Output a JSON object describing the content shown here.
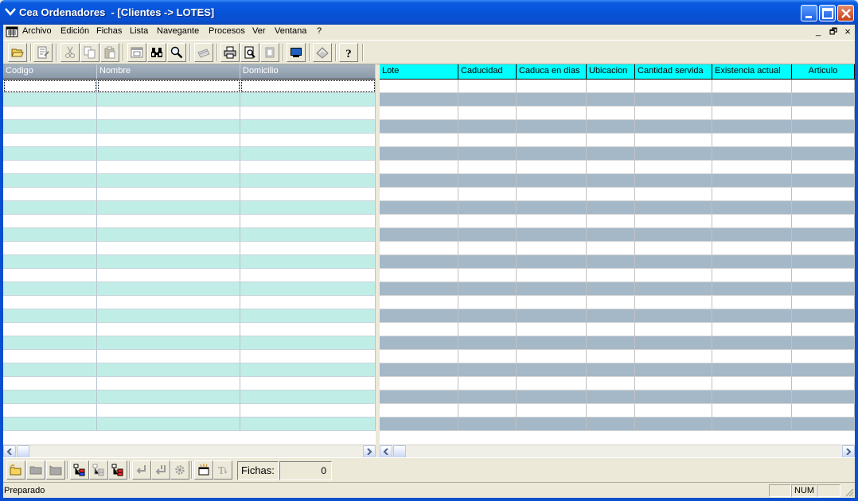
{
  "window": {
    "title": "Cea Ordenadores  - [Clientes -> LOTES]"
  },
  "menubar": {
    "items": [
      "Archivo",
      "Edición",
      "Fichas",
      "Lista",
      "Navegante",
      "Procesos",
      "Ver",
      "Ventana",
      "?"
    ],
    "mdi_min": "_",
    "mdi_restore": "🗗",
    "mdi_close": "×"
  },
  "toolbar": {
    "icons": [
      "open-folder-icon",
      "edit-record-icon",
      "cut-icon",
      "copy-icon",
      "paste-icon",
      "form-view-icon",
      "binoculars-icon",
      "magnifier-icon",
      "scanner-icon",
      "printer-icon",
      "print-preview-icon",
      "page-setup-icon",
      "monitor-icon",
      "eraser-icon",
      "help-icon"
    ]
  },
  "left_grid": {
    "columns": [
      "Codigo",
      "Nombre",
      "Domicilio"
    ],
    "row_count": 26
  },
  "right_grid": {
    "columns": [
      "Lote",
      "Caducidad",
      "Caduca en dias",
      "Ubicacion",
      "Cantidad servida",
      "Existencia actual",
      "Articulo"
    ],
    "row_count": 26
  },
  "bottombar": {
    "fichas_label": "Fichas:",
    "fichas_value": "0"
  },
  "statusbar": {
    "text": "Preparado",
    "num": "NUM"
  },
  "colors": {
    "title_blue": "#0753d9",
    "left_row_alt": "#c0eee6",
    "right_row_alt": "#a4b8c8",
    "right_header": "#00ffff"
  }
}
